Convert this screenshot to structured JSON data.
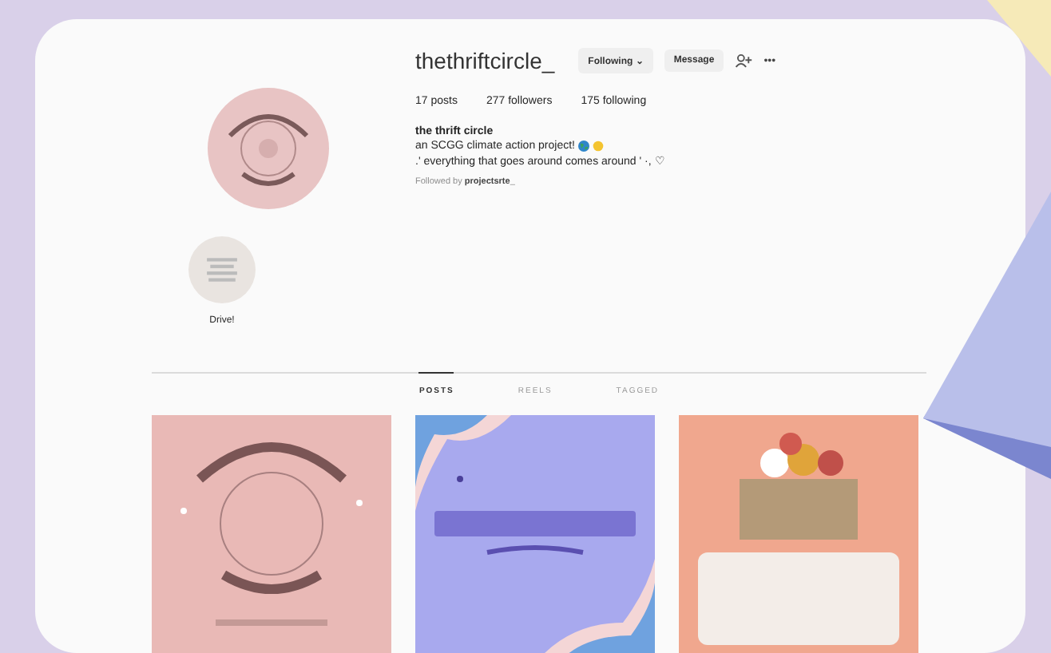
{
  "profile": {
    "username": "thethriftcircle_",
    "following_button": "Following ⌄",
    "message_button": "Message",
    "more_button": "•••",
    "stats": [
      "17 posts",
      "277 followers",
      "175 following"
    ],
    "display_name": "the thrift circle",
    "bio": [
      "an SCGG climate action project!",
      ".' everything that goes around comes around ' ·, ♡"
    ],
    "followed_by": "Followed by **projectsrte_**"
  },
  "highlights": [
    {
      "label": "Drive!"
    }
  ],
  "tabs": [
    {
      "label": "POSTS",
      "selected": true
    },
    {
      "label": "REELS",
      "selected": false
    },
    {
      "label": "TAGGED",
      "selected": false
    }
  ]
}
